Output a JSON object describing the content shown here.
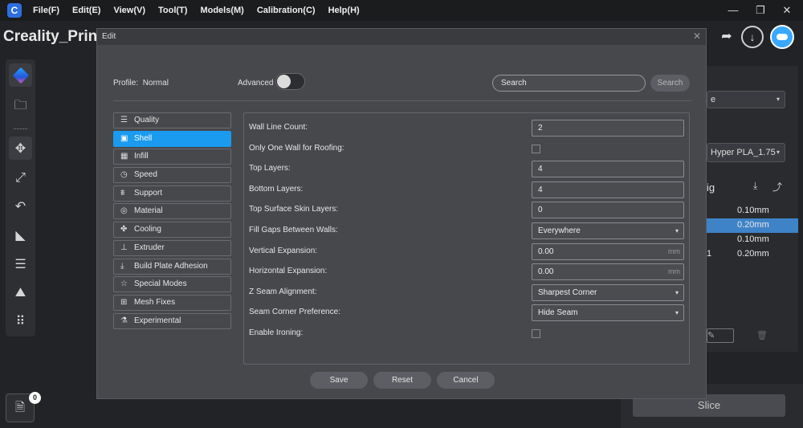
{
  "menubar": {
    "logo": "C",
    "items": [
      "File(F)",
      "Edit(E)",
      "View(V)",
      "Tool(T)",
      "Models(M)",
      "Calibration(C)",
      "Help(H)"
    ],
    "window_controls": {
      "minimize": "—",
      "maximize": "❐",
      "close": "✕"
    }
  },
  "app": {
    "title": "Creality_Print"
  },
  "top_tools": {
    "redo_glyph": "➦",
    "download_glyph": "↓"
  },
  "left_toolbar": {
    "icons": [
      "cube-logo-icon",
      "folder-icon",
      "move-icon",
      "scale-icon",
      "rotate-icon",
      "lay-flat-icon",
      "list-icon",
      "support-icon",
      "apps-icon"
    ],
    "glyphs": [
      "",
      "🗀",
      "✥",
      "⤢",
      "↶",
      "◣",
      "☰",
      "⛰",
      "⠿"
    ]
  },
  "file_badge": {
    "count": "0",
    "glyph": "🗎"
  },
  "right_panel": {
    "select1_value": "e",
    "select2_value": "Hyper PLA_1.75",
    "heading": "ig",
    "rows": [
      {
        "num": "",
        "value": "0.10mm",
        "selected": false
      },
      {
        "num": "",
        "value": "0.20mm",
        "selected": true
      },
      {
        "num": "",
        "value": "0.10mm",
        "selected": false
      },
      {
        "num": "1",
        "value": "0.20mm",
        "selected": false
      }
    ],
    "edit_glyph": "✎",
    "trash_glyph": "🗑",
    "slice_label": "Slice"
  },
  "dialog": {
    "title": "Edit",
    "close_glyph": "✕",
    "profile_label": "Profile:",
    "profile_value": "Normal",
    "advanced_label": "Advanced",
    "advanced_on": false,
    "search_value": "Search",
    "search_button": "Search",
    "categories": [
      {
        "label": "Quality",
        "icon": "quality-icon",
        "glyph": "☰",
        "active": false
      },
      {
        "label": "Shell",
        "icon": "shell-icon",
        "glyph": "▣",
        "active": true
      },
      {
        "label": "Infill",
        "icon": "infill-icon",
        "glyph": "▦",
        "active": false
      },
      {
        "label": "Speed",
        "icon": "speed-icon",
        "glyph": "◷",
        "active": false
      },
      {
        "label": "Support",
        "icon": "support-icon",
        "glyph": "⩩",
        "active": false
      },
      {
        "label": "Material",
        "icon": "material-icon",
        "glyph": "◎",
        "active": false
      },
      {
        "label": "Cooling",
        "icon": "fan-icon",
        "glyph": "✤",
        "active": false
      },
      {
        "label": "Extruder",
        "icon": "extruder-icon",
        "glyph": "⊥",
        "active": false
      },
      {
        "label": "Build Plate Adhesion",
        "icon": "adhesion-icon",
        "glyph": "⤓",
        "active": false
      },
      {
        "label": "Special Modes",
        "icon": "star-icon",
        "glyph": "☆",
        "active": false
      },
      {
        "label": "Mesh Fixes",
        "icon": "mesh-fix-icon",
        "glyph": "⊞",
        "active": false
      },
      {
        "label": "Experimental",
        "icon": "flask-icon",
        "glyph": "⚗",
        "active": false
      }
    ],
    "settings": [
      {
        "label": "Wall Line Count:",
        "type": "text",
        "value": "2",
        "unit": ""
      },
      {
        "label": "Only One Wall for Roofing:",
        "type": "checkbox",
        "value": "",
        "unit": "",
        "checked": false
      },
      {
        "label": "Top Layers:",
        "type": "text",
        "value": "4",
        "unit": ""
      },
      {
        "label": "Bottom Layers:",
        "type": "text",
        "value": "4",
        "unit": ""
      },
      {
        "label": "Top Surface Skin Layers:",
        "type": "text",
        "value": "0",
        "unit": ""
      },
      {
        "label": "Fill Gaps Between Walls:",
        "type": "select",
        "value": "Everywhere",
        "unit": ""
      },
      {
        "label": "Vertical Expansion:",
        "type": "text",
        "value": "0.00",
        "unit": "mm"
      },
      {
        "label": "Horizontal Expansion:",
        "type": "text",
        "value": "0.00",
        "unit": "mm"
      },
      {
        "label": "Z Seam Alignment:",
        "type": "select",
        "value": "Sharpest Corner",
        "unit": ""
      },
      {
        "label": "Seam Corner Preference:",
        "type": "select",
        "value": "Hide Seam",
        "unit": ""
      },
      {
        "label": "Enable Ironing:",
        "type": "checkbox",
        "value": "",
        "unit": "",
        "checked": false
      }
    ],
    "buttons": {
      "save": "Save",
      "reset": "Reset",
      "cancel": "Cancel"
    }
  },
  "colors": {
    "accent": "#1a9bef",
    "background": "#222326",
    "dialog_bg": "#47484c"
  }
}
